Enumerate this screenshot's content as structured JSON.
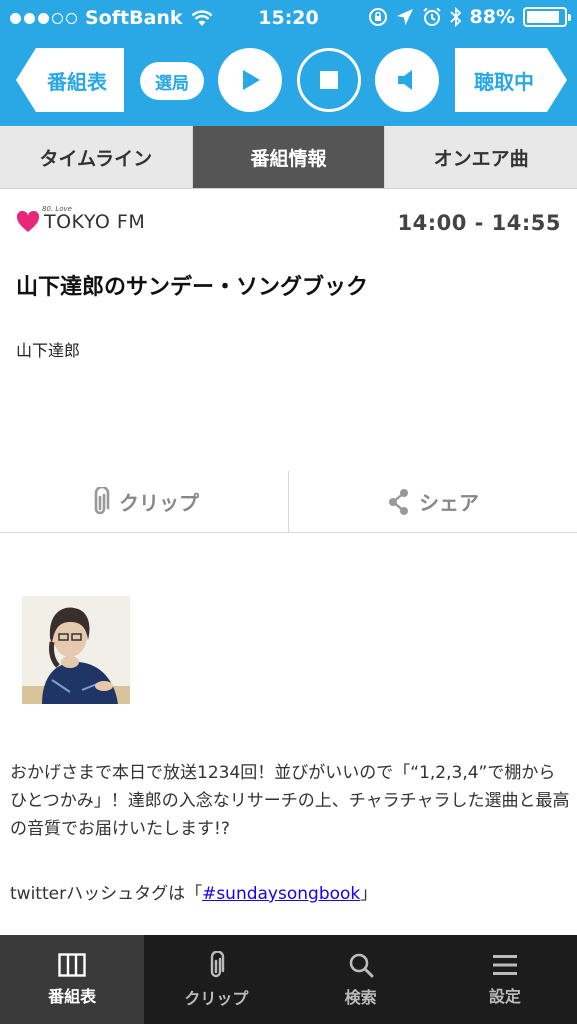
{
  "status_bar": {
    "carrier": "SoftBank",
    "time": "15:20",
    "battery": "88%",
    "battery_level": 0.88,
    "signal_bars_filled": 3,
    "signal_bars_total": 5
  },
  "player": {
    "back_label": "番組表",
    "station_select_label": "選局",
    "forward_label": "聴取中",
    "play_icon": "play-icon",
    "stop_icon": "stop-icon",
    "mute_icon": "speaker-icon"
  },
  "tabs": [
    {
      "label": "タイムライン",
      "active": false
    },
    {
      "label": "番組情報",
      "active": true
    },
    {
      "label": "オンエア曲",
      "active": false
    }
  ],
  "program": {
    "station_logo_small": "80. Love",
    "station_logo": "TOKYO FM",
    "airtime": "14:00 - 14:55",
    "title": "山下達郎のサンデー・ソングブック",
    "performer": "山下達郎",
    "clip_label": "クリップ",
    "share_label": "シェア",
    "description": "おかげさまで本日で放送1234回！並びがいいので「“1,2,3,4”で棚からひとつかみ」！達郎の入念なリサーチの上、チャラチャラした選曲と最高の音質でお届けいたします!?",
    "twitter_prefix": "twitterハッシュタグは「",
    "twitter_tag": "#sundaysongbook",
    "twitter_suffix": "」"
  },
  "bottom_nav": [
    {
      "label": "番組表",
      "icon": "grid-icon",
      "active": true
    },
    {
      "label": "クリップ",
      "icon": "paperclip-icon",
      "active": false
    },
    {
      "label": "検索",
      "icon": "search-icon",
      "active": false
    },
    {
      "label": "設定",
      "icon": "menu-icon",
      "active": false
    }
  ],
  "colors": {
    "accent": "#2aa8e6",
    "tab_active": "#555555",
    "nav_bg": "#1c1c1c",
    "logo_heart": "#e6287a",
    "link": "#1a00ee"
  }
}
